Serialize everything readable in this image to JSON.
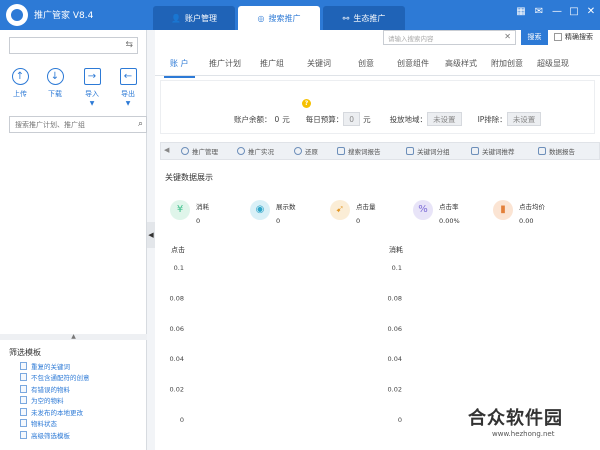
{
  "app": {
    "title": "推广管家 V8.4"
  },
  "main_tabs": [
    {
      "label": "账户管理",
      "icon": "user-icon"
    },
    {
      "label": "搜索推广",
      "icon": "search-icon"
    },
    {
      "label": "生态推广",
      "icon": "network-icon"
    }
  ],
  "window_controls": [
    "▦",
    "✉",
    "—",
    "□",
    "✕"
  ],
  "sidebar": {
    "buttons": [
      {
        "label": "上传",
        "icon": "upload-icon",
        "glyph": "↑"
      },
      {
        "label": "下载",
        "icon": "download-icon",
        "glyph": "↓"
      },
      {
        "label": "导入",
        "icon": "import-icon",
        "glyph": "→"
      },
      {
        "label": "导出",
        "icon": "export-icon",
        "glyph": "←"
      }
    ],
    "search_placeholder": "搜索推广计划、推广组",
    "filter_title": "筛选模板",
    "filter_items": [
      "重复的关键词",
      "不包含通配符的创意",
      "有错误的物料",
      "为空的物料",
      "未发布的本地更改",
      "物料状态",
      "高级筛选模板"
    ]
  },
  "top_search": {
    "placeholder": "请输入搜索内容",
    "button": "搜索",
    "exact_label": "精确搜索"
  },
  "sub_tabs": [
    "账 户",
    "推广计划",
    "推广组",
    "关键词",
    "创意",
    "创意组件",
    "高级样式",
    "附加创意",
    "超级显现"
  ],
  "account": {
    "balance_label": "账户余额：",
    "balance_value": "0",
    "balance_unit": "元",
    "budget_label": "每日预算：",
    "budget_value": "0",
    "budget_unit": "元",
    "region_label": "投放地域：",
    "region_value": "未设置",
    "ip_label": "IP排除：",
    "ip_value": "未设置"
  },
  "toolbar": [
    {
      "label": "推广管理",
      "icon": "gear-icon"
    },
    {
      "label": "推广实况",
      "icon": "clock-icon"
    },
    {
      "label": "还原",
      "icon": "undo-icon"
    },
    {
      "label": "搜索词报告",
      "icon": "report-icon"
    },
    {
      "label": "关键词分组",
      "icon": "group-icon"
    },
    {
      "label": "关键词推荐",
      "icon": "recommend-icon"
    },
    {
      "label": "数据报告",
      "icon": "data-report-icon"
    }
  ],
  "key_data": {
    "title": "关键数据展示",
    "metrics": [
      {
        "label": "消耗",
        "value": "0",
        "icon": "yen-icon",
        "glyph": "¥",
        "color": "#3bbf8a",
        "bg": "#dff5ea"
      },
      {
        "label": "展示数",
        "value": "0",
        "icon": "eye-icon",
        "glyph": "◉",
        "color": "#2fa6c9",
        "bg": "#d9f0f7"
      },
      {
        "label": "点击量",
        "value": "0",
        "icon": "cursor-icon",
        "glyph": "➹",
        "color": "#e39a2c",
        "bg": "#fbedd6"
      },
      {
        "label": "点击率",
        "value": "0.00%",
        "icon": "percent-icon",
        "glyph": "%",
        "color": "#7b6ad6",
        "bg": "#e8e4f8"
      },
      {
        "label": "点击均价",
        "value": "0.00",
        "icon": "bar-chart-icon",
        "glyph": "▮",
        "color": "#e3803a",
        "bg": "#fbe4d3"
      }
    ]
  },
  "chart_data": [
    {
      "type": "line",
      "title": "点击",
      "ylim": [
        0,
        0.1
      ],
      "y_ticks": [
        "0.1",
        "0.08",
        "0.06",
        "0.04",
        "0.02",
        "0"
      ],
      "series": []
    },
    {
      "type": "line",
      "title": "消耗",
      "ylim": [
        0,
        0.1
      ],
      "y_ticks": [
        "0.1",
        "0.08",
        "0.06",
        "0.04",
        "0.02",
        "0"
      ],
      "series": []
    }
  ],
  "watermark": {
    "text": "合众软件园",
    "url": "www.hezhong.net"
  }
}
